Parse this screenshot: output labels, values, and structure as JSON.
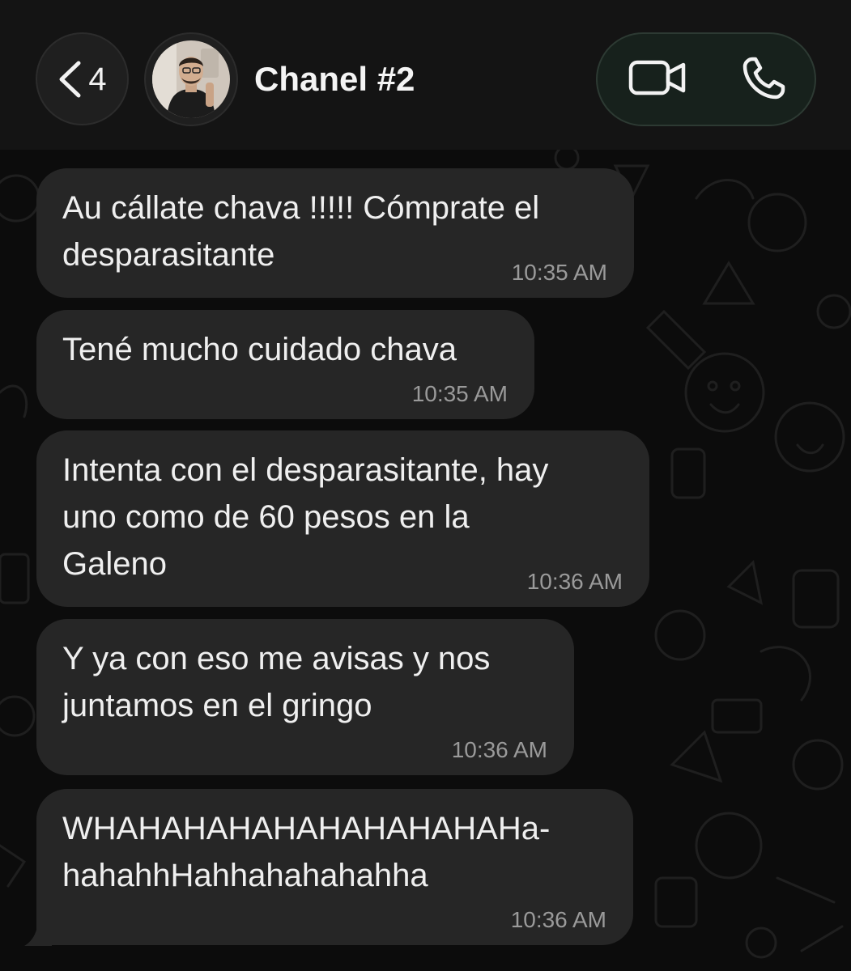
{
  "header": {
    "back_count": "4",
    "contact_name": "Chanel #2",
    "back_icon": "chevron-left-icon",
    "video_icon": "video-camera-icon",
    "call_icon": "phone-icon"
  },
  "theme": {
    "background": "#0d0d0d",
    "bubble": "#262626",
    "text": "#efefef",
    "timestamp": "#9a9a9a",
    "call_pill": "#17211c"
  },
  "messages": [
    {
      "text": "Au cállate chava !!!!! Cómprate el\ndesparasitante",
      "time": "10:35 AM"
    },
    {
      "text": "Tené mucho cuidado chava",
      "time": "10:35 AM"
    },
    {
      "text": "Intenta con el desparasitante, hay\nuno como de 60 pesos en la\nGaleno",
      "time": "10:36 AM"
    },
    {
      "text": "Y ya con eso me avisas y nos\njuntamos en el gringo",
      "time": "10:36 AM"
    },
    {
      "text": "WHAHAHAHAHAHAHAHAHAHa-\nhahahhHahhahahahahha",
      "time": "10:36 AM"
    }
  ]
}
